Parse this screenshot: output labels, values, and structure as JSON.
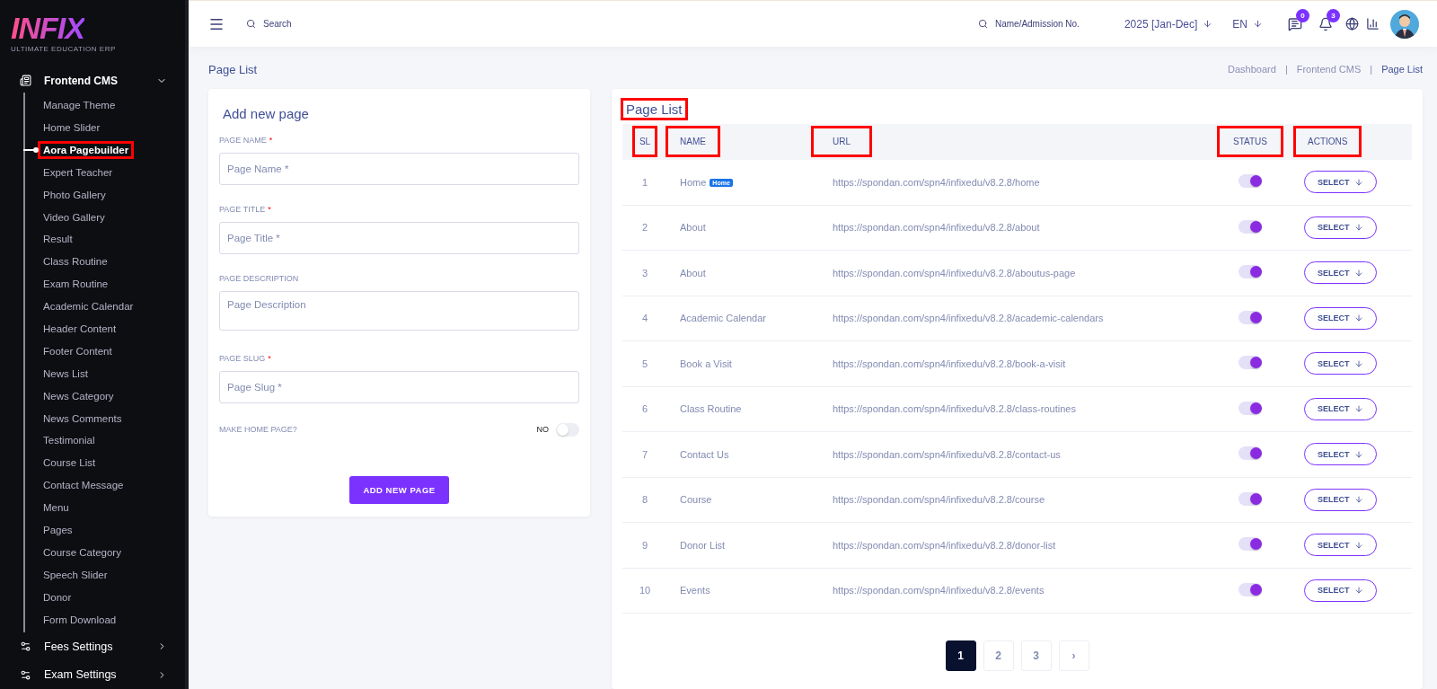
{
  "logo": {
    "name": "INFIX",
    "tagline": "ULTIMATE EDUCATION ERP"
  },
  "sidebar": {
    "items": [
      {
        "label": "Frontend CMS",
        "kind": "section",
        "expanded": true,
        "children": [
          {
            "label": "Manage Theme",
            "selected": false,
            "annotated": false
          },
          {
            "label": "Home Slider",
            "selected": false,
            "annotated": false
          },
          {
            "label": "Aora Pagebuilder",
            "selected": true,
            "annotated": true
          },
          {
            "label": "Expert Teacher",
            "selected": false,
            "annotated": false
          },
          {
            "label": "Photo Gallery",
            "selected": false,
            "annotated": false
          },
          {
            "label": "Video Gallery",
            "selected": false,
            "annotated": false
          },
          {
            "label": "Result",
            "selected": false,
            "annotated": false
          },
          {
            "label": "Class Routine",
            "selected": false,
            "annotated": false
          },
          {
            "label": "Exam Routine",
            "selected": false,
            "annotated": false
          },
          {
            "label": "Academic Calendar",
            "selected": false,
            "annotated": false
          },
          {
            "label": "Header Content",
            "selected": false,
            "annotated": false
          },
          {
            "label": "Footer Content",
            "selected": false,
            "annotated": false
          },
          {
            "label": "News List",
            "selected": false,
            "annotated": false
          },
          {
            "label": "News Category",
            "selected": false,
            "annotated": false
          },
          {
            "label": "News Comments",
            "selected": false,
            "annotated": false
          },
          {
            "label": "Testimonial",
            "selected": false,
            "annotated": false
          },
          {
            "label": "Course List",
            "selected": false,
            "annotated": false
          },
          {
            "label": "Contact Message",
            "selected": false,
            "annotated": false
          },
          {
            "label": "Menu",
            "selected": false,
            "annotated": false
          },
          {
            "label": "Pages",
            "selected": false,
            "annotated": false
          },
          {
            "label": "Course Category",
            "selected": false,
            "annotated": false
          },
          {
            "label": "Speech Slider",
            "selected": false,
            "annotated": false
          },
          {
            "label": "Donor",
            "selected": false,
            "annotated": false
          },
          {
            "label": "Form Download",
            "selected": false,
            "annotated": false
          }
        ]
      },
      {
        "label": "Fees Settings",
        "kind": "group",
        "expanded": false
      },
      {
        "label": "Exam Settings",
        "kind": "group",
        "expanded": false
      }
    ]
  },
  "topbar": {
    "search_placeholder": "Search",
    "student_search_placeholder": "Name/Admission No.",
    "session": "2025 [Jan-Dec]",
    "language": "EN",
    "messages_count": "0",
    "notifications_count": "3"
  },
  "page_title": "Page List",
  "breadcrumbs": [
    {
      "label": "Dashboard",
      "selected": false
    },
    {
      "label": "Frontend CMS",
      "selected": false
    },
    {
      "label": "Page List",
      "selected": true
    }
  ],
  "breadcrumb_separator": "|",
  "form": {
    "title": "Add new page",
    "fields": [
      {
        "label": "PAGE NAME",
        "required": true,
        "placeholder": "Page Name *",
        "kind": "input"
      },
      {
        "label": "PAGE TITLE",
        "required": true,
        "placeholder": "Page Title *",
        "kind": "input"
      },
      {
        "label": "PAGE DESCRIPTION",
        "required": false,
        "placeholder": "Page Description",
        "kind": "textarea"
      },
      {
        "label": "PAGE SLUG",
        "required": true,
        "placeholder": "Page Slug *",
        "kind": "input"
      }
    ],
    "required_mark": "*",
    "home_toggle": {
      "label": "MAKE HOME PAGE?",
      "value_label": "NO",
      "on": false
    },
    "submit": "ADD NEW PAGE"
  },
  "table": {
    "title": "Page List",
    "title_annotated": true,
    "columns": [
      {
        "label": "SL",
        "annotated": true
      },
      {
        "label": "NAME",
        "annotated": true
      },
      {
        "label": "URL",
        "annotated": true
      },
      {
        "label": "STATUS",
        "annotated": true
      },
      {
        "label": "ACTIONS",
        "annotated": true
      }
    ],
    "rows": [
      {
        "sl": "1",
        "name": "Home",
        "badge": "Home",
        "url": "https://spondan.com/spn4/infixedu/v8.2.8/home",
        "status": true,
        "action": "SELECT"
      },
      {
        "sl": "2",
        "name": "About",
        "url": "https://spondan.com/spn4/infixedu/v8.2.8/about",
        "status": true,
        "action": "SELECT"
      },
      {
        "sl": "3",
        "name": "About",
        "url": "https://spondan.com/spn4/infixedu/v8.2.8/aboutus-page",
        "status": true,
        "action": "SELECT"
      },
      {
        "sl": "4",
        "name": "Academic Calendar",
        "url": "https://spondan.com/spn4/infixedu/v8.2.8/academic-calendars",
        "status": true,
        "action": "SELECT"
      },
      {
        "sl": "5",
        "name": "Book a Visit",
        "url": "https://spondan.com/spn4/infixedu/v8.2.8/book-a-visit",
        "status": true,
        "action": "SELECT"
      },
      {
        "sl": "6",
        "name": "Class Routine",
        "url": "https://spondan.com/spn4/infixedu/v8.2.8/class-routines",
        "status": true,
        "action": "SELECT"
      },
      {
        "sl": "7",
        "name": "Contact Us",
        "url": "https://spondan.com/spn4/infixedu/v8.2.8/contact-us",
        "status": true,
        "action": "SELECT"
      },
      {
        "sl": "8",
        "name": "Course",
        "url": "https://spondan.com/spn4/infixedu/v8.2.8/course",
        "status": true,
        "action": "SELECT"
      },
      {
        "sl": "9",
        "name": "Donor List",
        "url": "https://spondan.com/spn4/infixedu/v8.2.8/donor-list",
        "status": true,
        "action": "SELECT"
      },
      {
        "sl": "10",
        "name": "Events",
        "url": "https://spondan.com/spn4/infixedu/v8.2.8/events",
        "status": true,
        "action": "SELECT"
      }
    ]
  },
  "pagination": {
    "pages": [
      {
        "label": "1",
        "selected": true
      },
      {
        "label": "2",
        "selected": false
      },
      {
        "label": "3",
        "selected": false
      }
    ],
    "next": "›"
  }
}
